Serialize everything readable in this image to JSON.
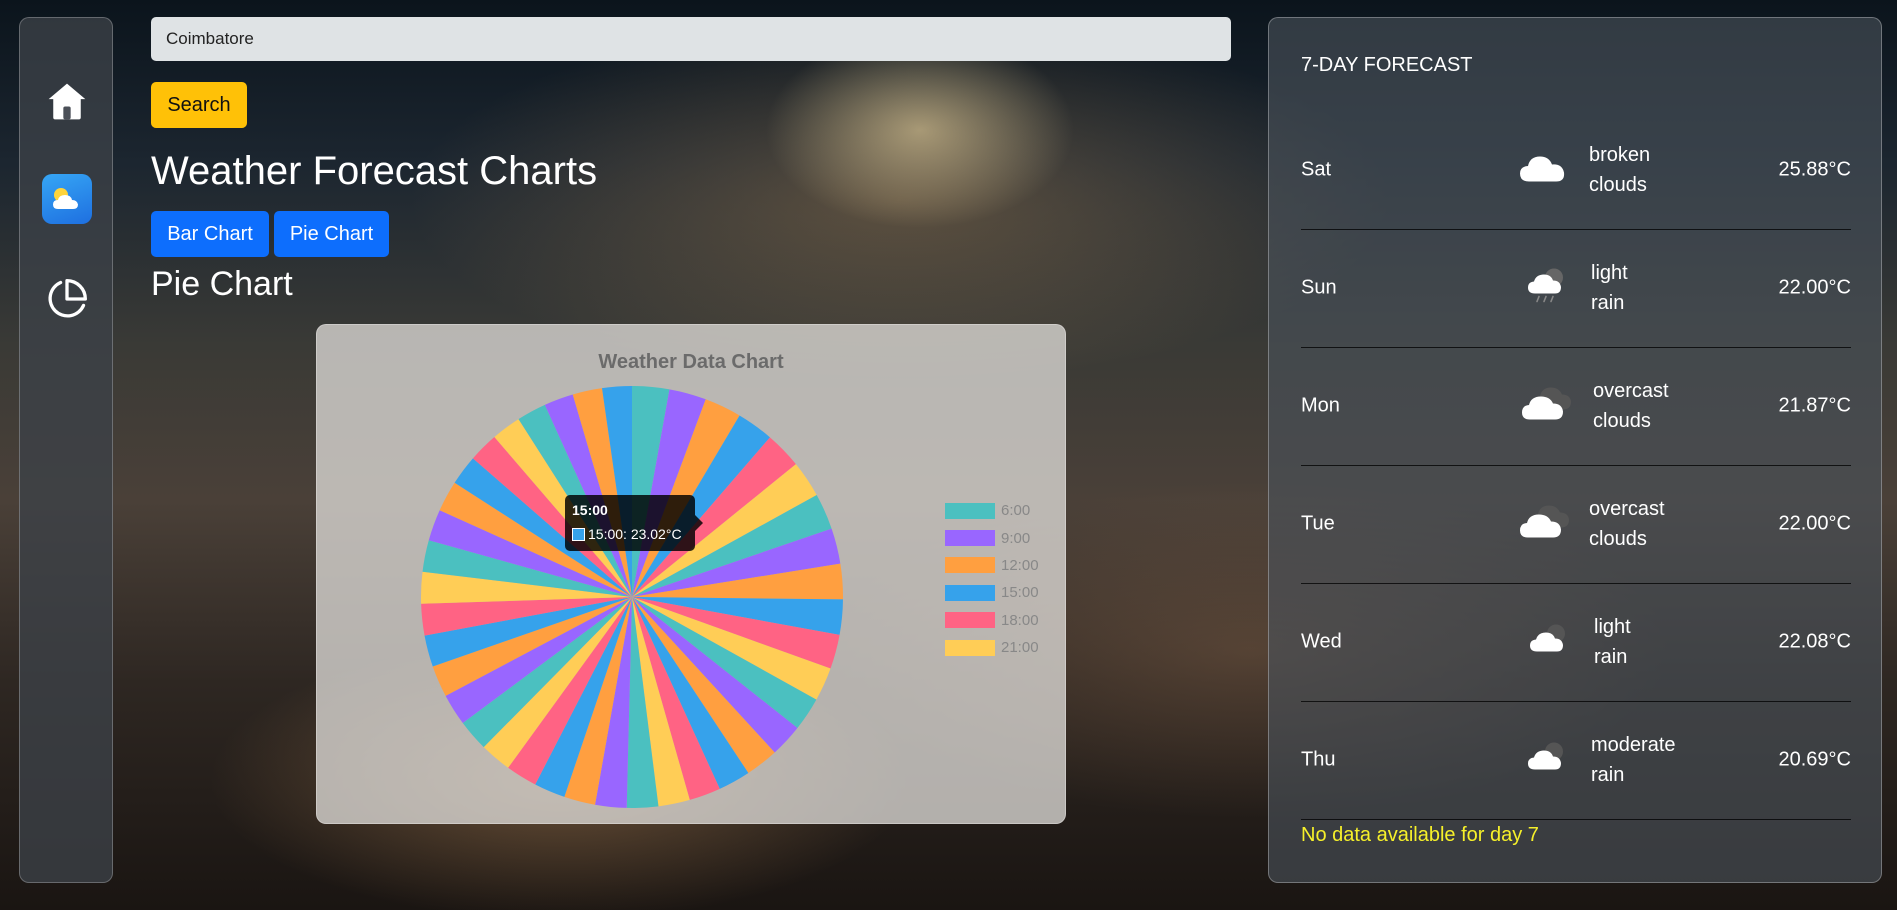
{
  "search": {
    "value": "Coimbatore",
    "button_label": "Search"
  },
  "page": {
    "title": "Weather Forecast Charts",
    "section_title": "Pie Chart"
  },
  "chart_buttons": {
    "bar": "Bar Chart",
    "pie": "Pie Chart"
  },
  "sidebar": {
    "items": [
      {
        "name": "home",
        "icon": "home-icon"
      },
      {
        "name": "weather",
        "icon": "weather-app-icon"
      },
      {
        "name": "charts",
        "icon": "pie-chart-icon"
      }
    ]
  },
  "chart_data": {
    "type": "pie",
    "title": "Weather Data Chart",
    "legend": [
      "6:00",
      "9:00",
      "12:00",
      "15:00",
      "18:00",
      "21:00"
    ],
    "legend_colors": [
      "#4bc0c0",
      "#9966ff",
      "#ff9f40",
      "#36a2eb",
      "#ff6384",
      "#ffcd56"
    ],
    "slice_colors": [
      "#4bc0c0",
      "#9966ff",
      "#ff9f40",
      "#36a2eb",
      "#ff6384",
      "#ffcd56",
      "#4bc0c0",
      "#9966ff",
      "#ff9f40",
      "#36a2eb",
      "#ff6384",
      "#ffcd56",
      "#4bc0c0",
      "#9966ff",
      "#ff9f40",
      "#36a2eb",
      "#ff6384",
      "#ffcd56",
      "#4bc0c0",
      "#9966ff",
      "#ff9f40",
      "#36a2eb",
      "#ff6384",
      "#ffcd56",
      "#4bc0c0",
      "#9966ff",
      "#ff9f40",
      "#36a2eb",
      "#ff6384",
      "#ffcd56",
      "#4bc0c0",
      "#9966ff",
      "#ff9f40",
      "#36a2eb",
      "#ff6384",
      "#ffcd56",
      "#4bc0c0",
      "#9966ff",
      "#ff9f40",
      "#36a2eb"
    ],
    "values": [
      25.9,
      25.9,
      25.8,
      25.8,
      25.7,
      25.6,
      25.3,
      24.9,
      24.7,
      24.5,
      24.0,
      23.5,
      23.5,
      23.0,
      23.0,
      22.5,
      22.0,
      22.0,
      21.9,
      21.9,
      21.8,
      21.8,
      21.9,
      22.0,
      22.0,
      22.1,
      22.1,
      22.0,
      22.0,
      22.1,
      22.1,
      22.0,
      21.5,
      21.0,
      20.8,
      20.7,
      20.6,
      20.5,
      20.6,
      20.7
    ],
    "tooltip": {
      "title": "15:00",
      "label": "15:00: 23.02°C",
      "color": "#36a2eb"
    }
  },
  "forecast": {
    "title": "7-DAY FORECAST",
    "days": [
      {
        "day": "Sat",
        "icon": "broken-clouds-icon",
        "desc_line1": "broken",
        "desc_line2": "clouds",
        "temp": "25.88°C"
      },
      {
        "day": "Sun",
        "icon": "light-rain-icon",
        "desc_line1": "light",
        "desc_line2": "rain",
        "temp": "22.00°C"
      },
      {
        "day": "Mon",
        "icon": "overcast-clouds-icon",
        "desc_line1": "overcast",
        "desc_line2": "clouds",
        "temp": "21.87°C"
      },
      {
        "day": "Tue",
        "icon": "overcast-clouds-icon",
        "desc_line1": "overcast",
        "desc_line2": "clouds",
        "temp": "22.00°C"
      },
      {
        "day": "Wed",
        "icon": "light-rain-icon",
        "desc_line1": "light",
        "desc_line2": "rain",
        "temp": "22.08°C"
      },
      {
        "day": "Thu",
        "icon": "moderate-rain-icon",
        "desc_line1": "moderate",
        "desc_line2": "rain",
        "temp": "20.69°C"
      }
    ],
    "no_data_message": "No data available for day 7"
  }
}
